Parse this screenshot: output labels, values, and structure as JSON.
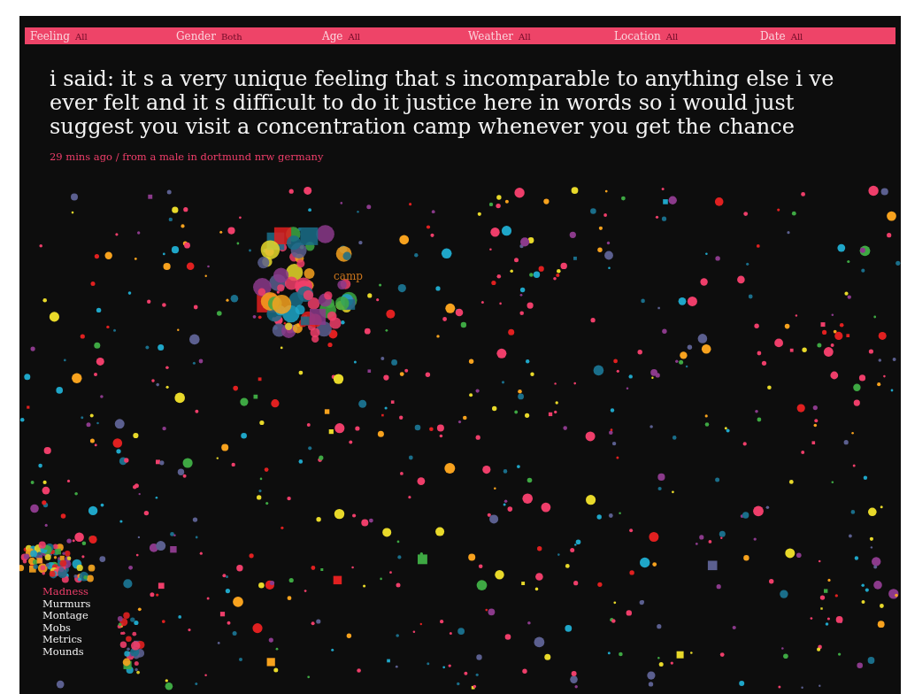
{
  "filters": [
    {
      "label": "Feeling",
      "value": "All"
    },
    {
      "label": "Gender",
      "value": "Both"
    },
    {
      "label": "Age",
      "value": "All"
    },
    {
      "label": "Weather",
      "value": "All"
    },
    {
      "label": "Location",
      "value": "All"
    },
    {
      "label": "Date",
      "value": "All"
    }
  ],
  "quote": "i said: it s a very unique feeling that s incomparable to anything else i ve ever felt and it s difficult to do it justice here in words so i would just suggest you visit a concentration camp whenever you get the chance",
  "meta": "29 mins ago / from a male in dortmund nrw germany",
  "cluster_label": "camp",
  "movements": [
    {
      "label": "Madness",
      "selected": true
    },
    {
      "label": "Murmurs",
      "selected": false
    },
    {
      "label": "Montage",
      "selected": false
    },
    {
      "label": "Mobs",
      "selected": false
    },
    {
      "label": "Metrics",
      "selected": false
    },
    {
      "label": "Mounds",
      "selected": false
    }
  ]
}
